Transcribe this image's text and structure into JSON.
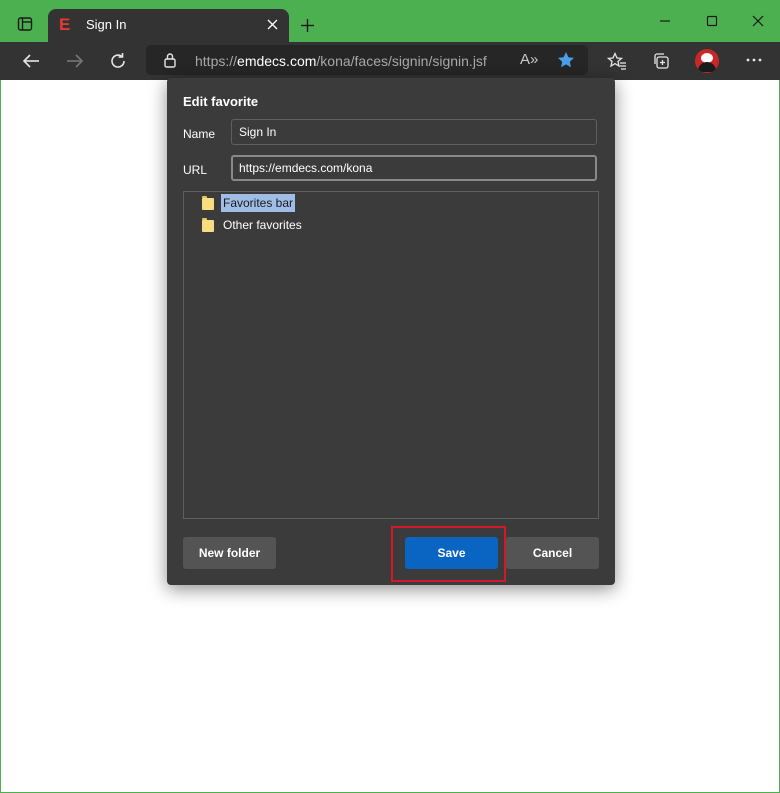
{
  "window": {
    "tab_title": "Sign In",
    "favicon_letter": "E",
    "accent_color": "#4caf50"
  },
  "toolbar": {
    "url_prefix": "https://",
    "url_domain": "emdecs.com",
    "url_path": "/kona/faces/signin/signin.jsf",
    "read_aloud_glyph": "A»"
  },
  "icons": {
    "tab_actions": "tab-actions-icon",
    "close": "close-icon",
    "new_tab": "plus-icon",
    "back": "back-arrow-icon",
    "forward": "forward-arrow-icon",
    "refresh": "refresh-icon",
    "lock": "lock-icon",
    "favorite": "star-filled-icon",
    "favorites": "favorites-icon",
    "collections": "collections-icon",
    "more": "more-icon"
  },
  "dialog": {
    "title": "Edit favorite",
    "name_label": "Name",
    "name_value": "Sign In",
    "url_label": "URL",
    "url_value": "https://emdecs.com/kona",
    "folders": [
      {
        "label": "Favorites bar",
        "selected": true
      },
      {
        "label": "Other favorites",
        "selected": false
      }
    ],
    "new_folder_label": "New folder",
    "save_label": "Save",
    "cancel_label": "Cancel",
    "save_color": "#0a64c2",
    "highlight_color": "#d3182a"
  }
}
